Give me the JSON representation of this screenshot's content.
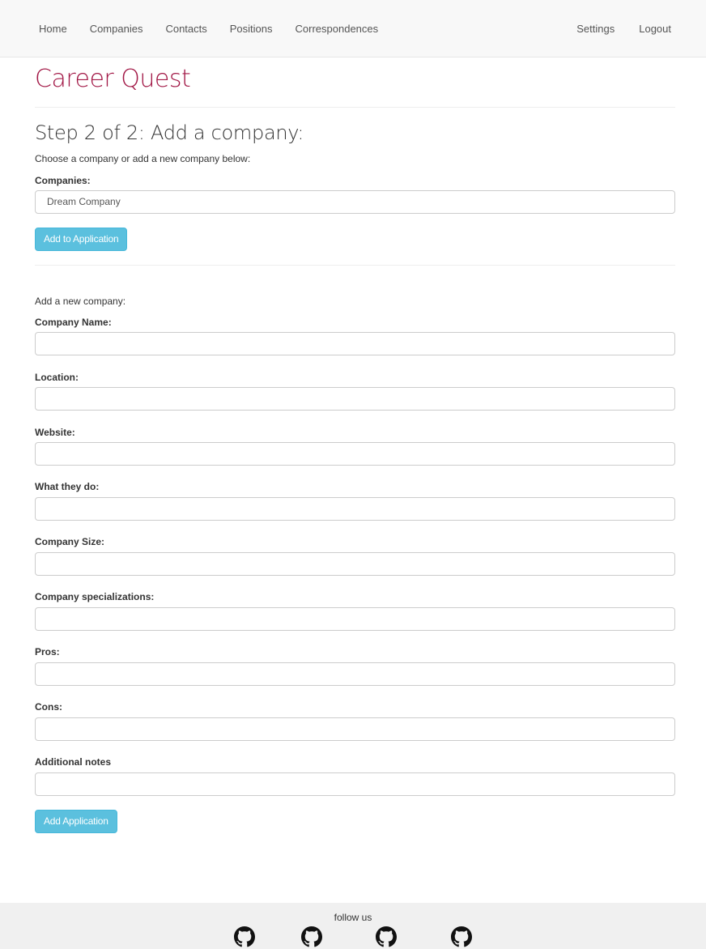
{
  "nav": {
    "left": [
      "Home",
      "Companies",
      "Contacts",
      "Positions",
      "Correspondences"
    ],
    "right": [
      "Settings",
      "Logout"
    ]
  },
  "brand": "Career Quest",
  "step_title": "Step 2 of 2: Add a company:",
  "choose_text": "Choose a company or add a new company below:",
  "companies": {
    "label": "Companies:",
    "selected": "Dream Company"
  },
  "add_to_application_label": "Add to Application",
  "new_company": {
    "intro": "Add a new company:",
    "fields": [
      {
        "label": "Company Name:",
        "value": ""
      },
      {
        "label": "Location:",
        "value": ""
      },
      {
        "label": "Website:",
        "value": ""
      },
      {
        "label": "What they do:",
        "value": ""
      },
      {
        "label": "Company Size:",
        "value": ""
      },
      {
        "label": "Company specializations:",
        "value": ""
      },
      {
        "label": "Pros:",
        "value": ""
      },
      {
        "label": "Cons:",
        "value": ""
      },
      {
        "label": "Additional notes",
        "value": ""
      }
    ]
  },
  "add_application_label": "Add Application",
  "footer": {
    "follow": "follow us",
    "icons": [
      "github-icon",
      "github-icon",
      "github-icon",
      "github-icon"
    ]
  },
  "colors": {
    "brand": "#a21846",
    "button": "#5bc0de",
    "navbar": "#f8f8f8",
    "footer": "#f0f0f0"
  }
}
